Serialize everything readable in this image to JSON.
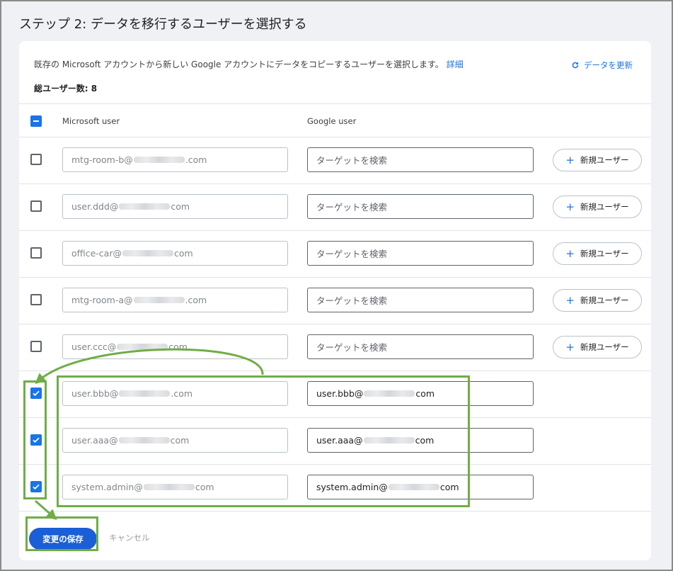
{
  "page": {
    "title": "ステップ 2: データを移行するユーザーを選択する"
  },
  "card": {
    "description": "既存の Microsoft アカウントから新しい Google アカウントにデータをコピーするユーザーを選択します。",
    "details_link": "詳細",
    "refresh_label": "データを更新",
    "total_users": "総ユーザー数: 8"
  },
  "table": {
    "col_microsoft": "Microsoft user",
    "col_google": "Google user",
    "new_user_label": "新規ユーザー",
    "target_placeholder": "ターゲットを検索",
    "rows": [
      {
        "ms_prefix": "mtg-room-b@",
        "ms_suffix": ".com",
        "checked": false,
        "google_prefix": "",
        "google_suffix": ""
      },
      {
        "ms_prefix": "user.ddd@",
        "ms_suffix": "com",
        "checked": false,
        "google_prefix": "",
        "google_suffix": ""
      },
      {
        "ms_prefix": "office-car@",
        "ms_suffix": "com",
        "checked": false,
        "google_prefix": "",
        "google_suffix": ""
      },
      {
        "ms_prefix": "mtg-room-a@",
        "ms_suffix": ".com",
        "checked": false,
        "google_prefix": "",
        "google_suffix": ""
      },
      {
        "ms_prefix": "user.ccc@",
        "ms_suffix": "com",
        "checked": false,
        "google_prefix": "",
        "google_suffix": ""
      },
      {
        "ms_prefix": "user.bbb@",
        "ms_suffix": ".com",
        "checked": true,
        "google_prefix": "user.bbb@",
        "google_suffix": "com"
      },
      {
        "ms_prefix": "user.aaa@",
        "ms_suffix": "com",
        "checked": true,
        "google_prefix": "user.aaa@",
        "google_suffix": "com"
      },
      {
        "ms_prefix": "system.admin@",
        "ms_suffix": "com",
        "checked": true,
        "google_prefix": "system.admin@",
        "google_suffix": "com"
      }
    ]
  },
  "footer": {
    "save_label": "変更の保存",
    "cancel_label": "キャンセル"
  },
  "colors": {
    "accent": "#1a73e8",
    "save_button": "#1a5fd6",
    "annotation": "#70ad47"
  },
  "icons": {
    "refresh": "refresh-icon",
    "plus": "plus-icon",
    "check": "check-icon"
  }
}
